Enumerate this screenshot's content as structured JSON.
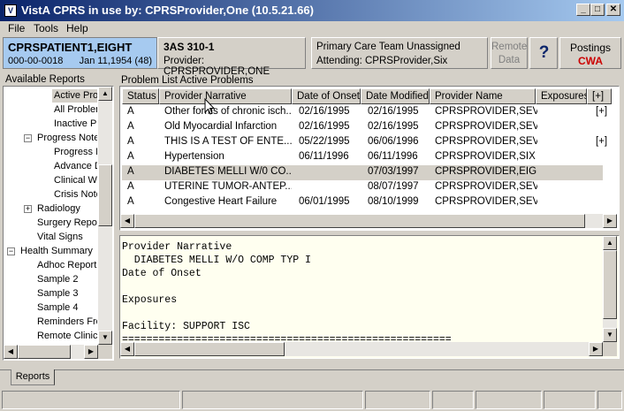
{
  "window": {
    "title": "VistA CPRS in use by:  CPRSProvider,One  (10.5.21.66)",
    "app_icon": "vista-app-icon",
    "controls": {
      "minimize": "_",
      "maximize": "□",
      "close": "✕"
    }
  },
  "menu": [
    "File",
    "Tools",
    "Help"
  ],
  "patient": {
    "name": "CPRSPATIENT1,EIGHT",
    "ssn": "000-00-0018",
    "dob": "Jan 11,1954 (48)"
  },
  "location": {
    "name": "3AS 310-1",
    "provider": "Provider:  CPRSPROVIDER,ONE"
  },
  "team": {
    "line1": "Primary Care Team Unassigned",
    "line2": "Attending:  CPRSProvider,Six"
  },
  "remote": {
    "line1": "Remote",
    "line2": "Data"
  },
  "help_glyph": "?",
  "postings": {
    "line1": "Postings",
    "line2": "CWA",
    "accent": "#cc0000"
  },
  "reports_tree": {
    "label": "Available Reports",
    "items": [
      {
        "label": "Active Problems",
        "toggle": "",
        "level": 3,
        "selected": true
      },
      {
        "label": "All Problems",
        "toggle": "",
        "level": 3
      },
      {
        "label": "Inactive Problems",
        "toggle": "",
        "level": 3
      },
      {
        "label": "Progress Notes",
        "toggle": "−",
        "level": 2
      },
      {
        "label": "Progress Notes",
        "toggle": "",
        "level": 3
      },
      {
        "label": "Advance Directive",
        "toggle": "",
        "level": 3
      },
      {
        "label": "Clinical Warnings",
        "toggle": "",
        "level": 3
      },
      {
        "label": "Crisis Notes",
        "toggle": "",
        "level": 3
      },
      {
        "label": "Radiology",
        "toggle": "+",
        "level": 2
      },
      {
        "label": "Surgery Reports",
        "toggle": "",
        "level": 2
      },
      {
        "label": "Vital Signs",
        "toggle": "",
        "level": 2
      },
      {
        "label": "Health Summary",
        "toggle": "−",
        "level": 1
      },
      {
        "label": "Adhoc Report",
        "toggle": "",
        "level": 2
      },
      {
        "label": "Sample 2",
        "toggle": "",
        "level": 2
      },
      {
        "label": "Sample 3",
        "toggle": "",
        "level": 2
      },
      {
        "label": "Sample 4",
        "toggle": "",
        "level": 2
      },
      {
        "label": "Reminders Frozen",
        "toggle": "",
        "level": 2
      },
      {
        "label": "Remote Clinical",
        "toggle": "",
        "level": 2
      }
    ]
  },
  "problem_list": {
    "label": "Problem List Active Problems",
    "columns": [
      "Status",
      "Provider Narrative",
      "Date of Onset",
      "Date Modified",
      "Provider Name",
      "Exposures",
      "[+]"
    ],
    "rows": [
      {
        "status": "A",
        "narrative": "Other forms of chronic isch...",
        "onset": "02/16/1995",
        "modified": "02/16/1995",
        "provider": "CPRSPROVIDER,SEV...",
        "exposures": "",
        "more": "[+]"
      },
      {
        "status": "A",
        "narrative": "Old Myocardial Infarction",
        "onset": "02/16/1995",
        "modified": "02/16/1995",
        "provider": "CPRSPROVIDER,SEV...",
        "exposures": "",
        "more": ""
      },
      {
        "status": "A",
        "narrative": "THIS IS A TEST OF ENTE...",
        "onset": "05/22/1995",
        "modified": "06/06/1996",
        "provider": "CPRSPROVIDER,SEV...",
        "exposures": "",
        "more": "[+]"
      },
      {
        "status": "A",
        "narrative": "Hypertension",
        "onset": "06/11/1996",
        "modified": "06/11/1996",
        "provider": "CPRSPROVIDER,SIX",
        "exposures": "",
        "more": ""
      },
      {
        "status": "A",
        "narrative": "DIABETES MELLI W/0 CO...",
        "onset": "",
        "modified": "07/03/1997",
        "provider": "CPRSPROVIDER,EIG...",
        "exposures": "",
        "more": "",
        "selected": true
      },
      {
        "status": "A",
        "narrative": "UTERINE TUMOR-ANTEP...",
        "onset": "",
        "modified": "08/07/1997",
        "provider": "CPRSPROVIDER,SEV...",
        "exposures": "",
        "more": ""
      },
      {
        "status": "A",
        "narrative": "Congestive Heart Failure",
        "onset": "06/01/1995",
        "modified": "08/10/1999",
        "provider": "CPRSPROVIDER,SEV...",
        "exposures": "",
        "more": ""
      }
    ]
  },
  "detail_text": "Provider Narrative\n  DIABETES MELLI W/O COMP TYP I\nDate of Onset\n\nExposures\n\nFacility: SUPPORT ISC\n======================================================",
  "tabs": [
    "Reports"
  ],
  "scroll_glyphs": {
    "up": "▲",
    "down": "▼",
    "left": "◀",
    "right": "▶"
  }
}
